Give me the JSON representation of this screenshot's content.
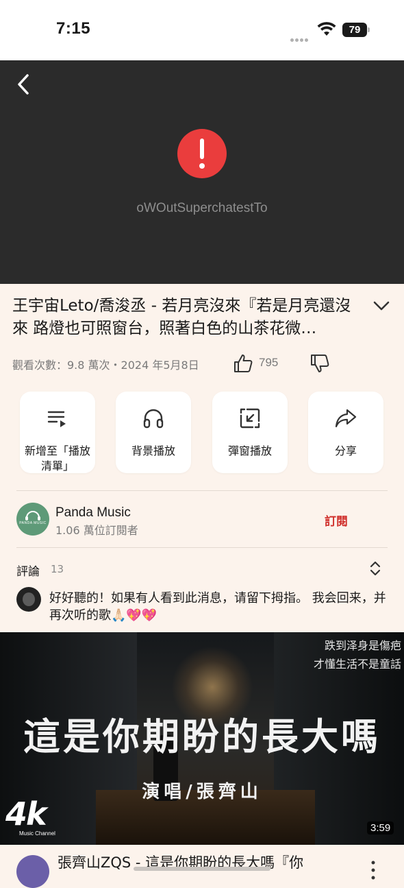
{
  "status_bar": {
    "time": "7:15",
    "battery": "79"
  },
  "player": {
    "error_message": "oWOutSuperchatestTo"
  },
  "video": {
    "title": "王宇宙Leto/喬浚丞 - 若月亮沒來『若是月亮還沒來 路燈也可照窗台，照著白色的山茶花微…",
    "meta": "觀看次數：9.8 萬次・2024 年5月8日",
    "likes": "795"
  },
  "actions": [
    {
      "label": "新增至「播放清單」",
      "icon": "playlist-add-icon"
    },
    {
      "label": "背景播放",
      "icon": "headphones-icon"
    },
    {
      "label": "彈窗播放",
      "icon": "picture-in-picture-icon"
    },
    {
      "label": "分享",
      "icon": "share-icon"
    }
  ],
  "channel": {
    "name": "Panda Music",
    "subscribers": "1.06 萬位訂閱者",
    "subscribe_label": "訂閱",
    "avatar_text": "PANDA MUSIC"
  },
  "comments": {
    "label": "評論",
    "count": "13",
    "top_comment": "好好聽的！如果有人看到此消息，请留下拇指。 我会回来，并再次听的歌🙏🏻💖💖"
  },
  "next_video": {
    "thumbnail_title": "這是你期盼的長大嗎",
    "thumbnail_singer": "演唱/張齊山",
    "thumbnail_quote_1": "跌到泽身是傷疤",
    "thumbnail_quote_2": "才懂生活不是童話",
    "logo": "4k",
    "logo_sub": "Music Channel",
    "duration": "3:59",
    "title": "張齊山ZQS - 這是你期盼的長大嗎『你"
  },
  "colors": {
    "accent_red": "#d0312d",
    "error_red": "#ea3d3d",
    "background": "#fcf3ec"
  }
}
